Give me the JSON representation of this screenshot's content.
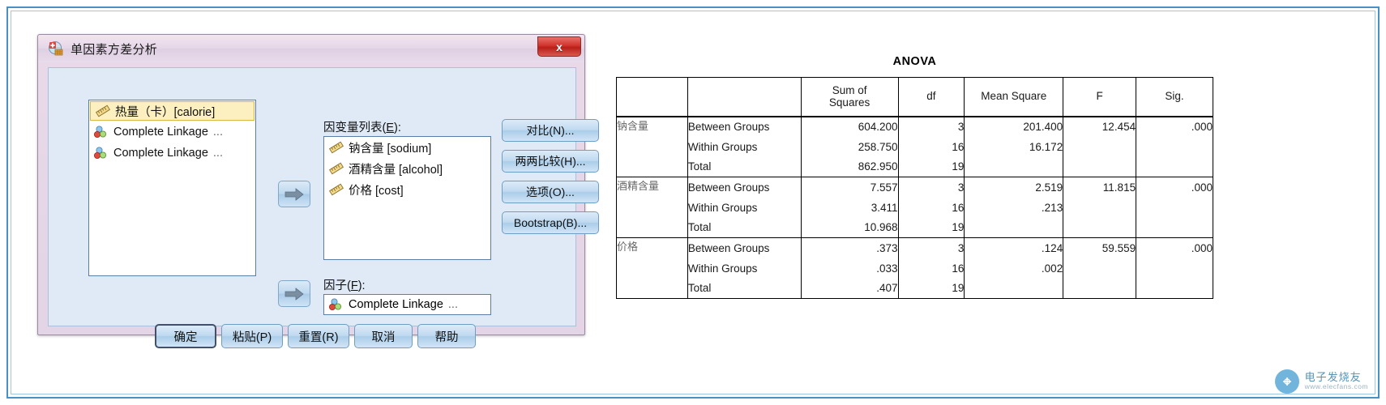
{
  "dialog": {
    "title": "单因素方差分析",
    "title_icon": "anova-dialog-icon",
    "close_label": "x",
    "source_list": {
      "items": [
        {
          "icon": "scale-variable-icon",
          "label": "热量（卡）[calorie]",
          "trailing": "",
          "selected": true
        },
        {
          "icon": "nominal-variable-icon",
          "label": "Complete Linkage",
          "trailing": "...",
          "selected": false
        },
        {
          "icon": "nominal-variable-icon",
          "label": "Complete Linkage",
          "trailing": "...",
          "selected": false
        }
      ]
    },
    "move_dependent_button": "move-to-dependent-arrow",
    "move_factor_button": "move-to-factor-arrow",
    "dependent": {
      "label_prefix": "因变量列表(",
      "label_key": "E",
      "label_suffix": "):",
      "items": [
        {
          "icon": "scale-variable-icon",
          "label": "钠含量 [sodium]"
        },
        {
          "icon": "scale-variable-icon",
          "label": "酒精含量 [alcohol]"
        },
        {
          "icon": "scale-variable-icon",
          "label": "价格 [cost]"
        }
      ]
    },
    "factor": {
      "label_prefix": "因子(",
      "label_key": "F",
      "label_suffix": "):",
      "value": "Complete Linkage",
      "value_trailing": "...",
      "icon": "nominal-variable-icon"
    },
    "command_buttons": [
      {
        "label": "对比(N)...",
        "name": "contrasts-button"
      },
      {
        "label": "两两比较(H)...",
        "name": "post-hoc-button"
      },
      {
        "label": "选项(O)...",
        "name": "options-button"
      },
      {
        "label": "Bootstrap(B)...",
        "name": "bootstrap-button"
      }
    ],
    "bottom_buttons": [
      {
        "label": "确定",
        "name": "ok-button",
        "default": true
      },
      {
        "label": "粘贴(P)",
        "name": "paste-button",
        "default": false
      },
      {
        "label": "重置(R)",
        "name": "reset-button",
        "default": false
      },
      {
        "label": "取消",
        "name": "cancel-button",
        "default": false
      },
      {
        "label": "帮助",
        "name": "help-button",
        "default": false
      }
    ]
  },
  "chart_data": {
    "type": "table",
    "title": "ANOVA",
    "columns": [
      "",
      "",
      "Sum of Squares",
      "df",
      "Mean Square",
      "F",
      "Sig."
    ],
    "header": {
      "blank": "",
      "sum_of_squares_l1": "Sum of",
      "sum_of_squares_l2": "Squares",
      "df": "df",
      "mean_square": "Mean Square",
      "f": "F",
      "sig": "Sig."
    },
    "groups": [
      {
        "factor": "钠含量",
        "rows": [
          {
            "source": "Between Groups",
            "ss": "604.200",
            "df": "3",
            "ms": "201.400",
            "f": "12.454",
            "sig": ".000"
          },
          {
            "source": "Within Groups",
            "ss": "258.750",
            "df": "16",
            "ms": "16.172",
            "f": "",
            "sig": ""
          },
          {
            "source": "Total",
            "ss": "862.950",
            "df": "19",
            "ms": "",
            "f": "",
            "sig": ""
          }
        ]
      },
      {
        "factor": "酒精含量",
        "rows": [
          {
            "source": "Between Groups",
            "ss": "7.557",
            "df": "3",
            "ms": "2.519",
            "f": "11.815",
            "sig": ".000"
          },
          {
            "source": "Within Groups",
            "ss": "3.411",
            "df": "16",
            "ms": ".213",
            "f": "",
            "sig": ""
          },
          {
            "source": "Total",
            "ss": "10.968",
            "df": "19",
            "ms": "",
            "f": "",
            "sig": ""
          }
        ]
      },
      {
        "factor": "价格",
        "rows": [
          {
            "source": "Between Groups",
            "ss": ".373",
            "df": "3",
            "ms": ".124",
            "f": "59.559",
            "sig": ".000"
          },
          {
            "source": "Within Groups",
            "ss": ".033",
            "df": "16",
            "ms": ".002",
            "f": "",
            "sig": ""
          },
          {
            "source": "Total",
            "ss": ".407",
            "df": "19",
            "ms": "",
            "f": "",
            "sig": ""
          }
        ]
      }
    ]
  },
  "watermark": {
    "logo_icon": "elecfans-logo-icon",
    "main": "电子发烧友",
    "sub": "www.elecfans.com"
  },
  "colors": {
    "frame_blue": "#4a90c4",
    "dialog_chrome": "#e3d4e6",
    "dialog_body": "#dfeaf6",
    "selection": "#fdf0c0",
    "close_red": "#d0342c",
    "watermark": "#3a7fa8"
  }
}
